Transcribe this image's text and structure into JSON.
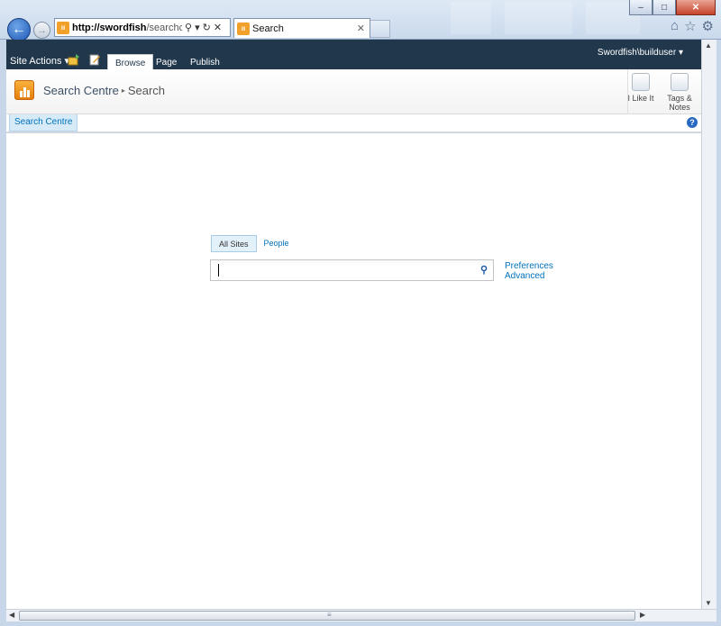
{
  "browser": {
    "address_host": "http://swordfish",
    "address_path": "/searchcentre/",
    "tab_title": "Search",
    "site_icon_glyph": "ıı"
  },
  "ribbon": {
    "site_actions": "Site Actions ▾",
    "tabs": [
      "Browse",
      "Page",
      "Publish"
    ],
    "active_tab": "Browse",
    "user": "Swordfish\\builduser ▾",
    "bg_color": "#21374c"
  },
  "header": {
    "site_title": "Search Centre",
    "breadcrumb_separator": "▸",
    "page_title": "Search",
    "i_like_it": "I Like It",
    "tags_notes": "Tags & Notes"
  },
  "topnav": {
    "items": [
      "Search Centre"
    ],
    "help_glyph": "?"
  },
  "search": {
    "scopes": [
      "All Sites",
      "People"
    ],
    "selected_scope": "All Sites",
    "query_value": "",
    "go_glyph": "⚲",
    "preferences_link": "Preferences",
    "advanced_link": "Advanced"
  },
  "accent_colors": {
    "link": "#0072bc",
    "logo": "#f1a12a"
  }
}
